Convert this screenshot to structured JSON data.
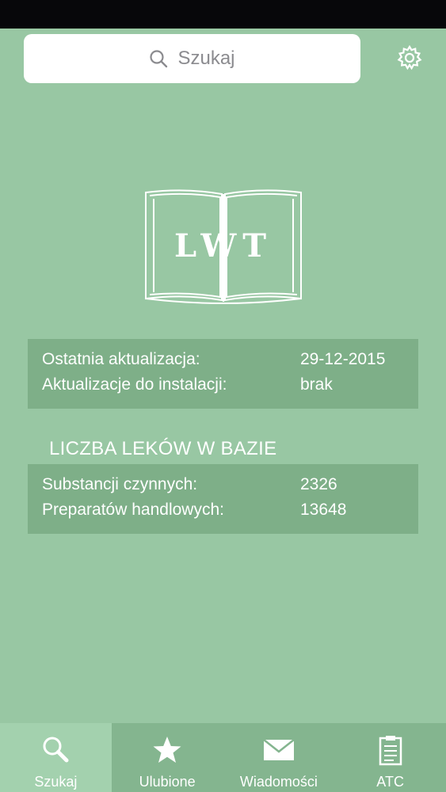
{
  "search": {
    "placeholder": "Szukaj",
    "icon": "search-icon"
  },
  "settings": {
    "icon": "gear-icon"
  },
  "logo": {
    "text": "LWT",
    "icon": "open-book-icon"
  },
  "update_info": {
    "rows": [
      {
        "label": "Ostatnia aktualizacja:",
        "value": "29-12-2015"
      },
      {
        "label": "Aktualizacje do instalacji:",
        "value": "brak"
      }
    ]
  },
  "drug_count": {
    "heading": "LICZBA LEKÓW W BAZIE",
    "rows": [
      {
        "label": "Substancji czynnych:",
        "value": "2326"
      },
      {
        "label": "Preparatów handlowych:",
        "value": "13648"
      }
    ]
  },
  "tabs": [
    {
      "label": "Szukaj",
      "icon": "search-icon",
      "active": true
    },
    {
      "label": "Ulubione",
      "icon": "star-icon",
      "active": false
    },
    {
      "label": "Wiadomości",
      "icon": "envelope-icon",
      "active": false
    },
    {
      "label": "ATC",
      "icon": "clipboard-icon",
      "active": false
    }
  ],
  "colors": {
    "background": "#98c7a3",
    "panel": "#7eaf88",
    "tab_bar": "#84b58f",
    "tab_active": "#a3d1ae",
    "status_bar": "#07070a"
  }
}
